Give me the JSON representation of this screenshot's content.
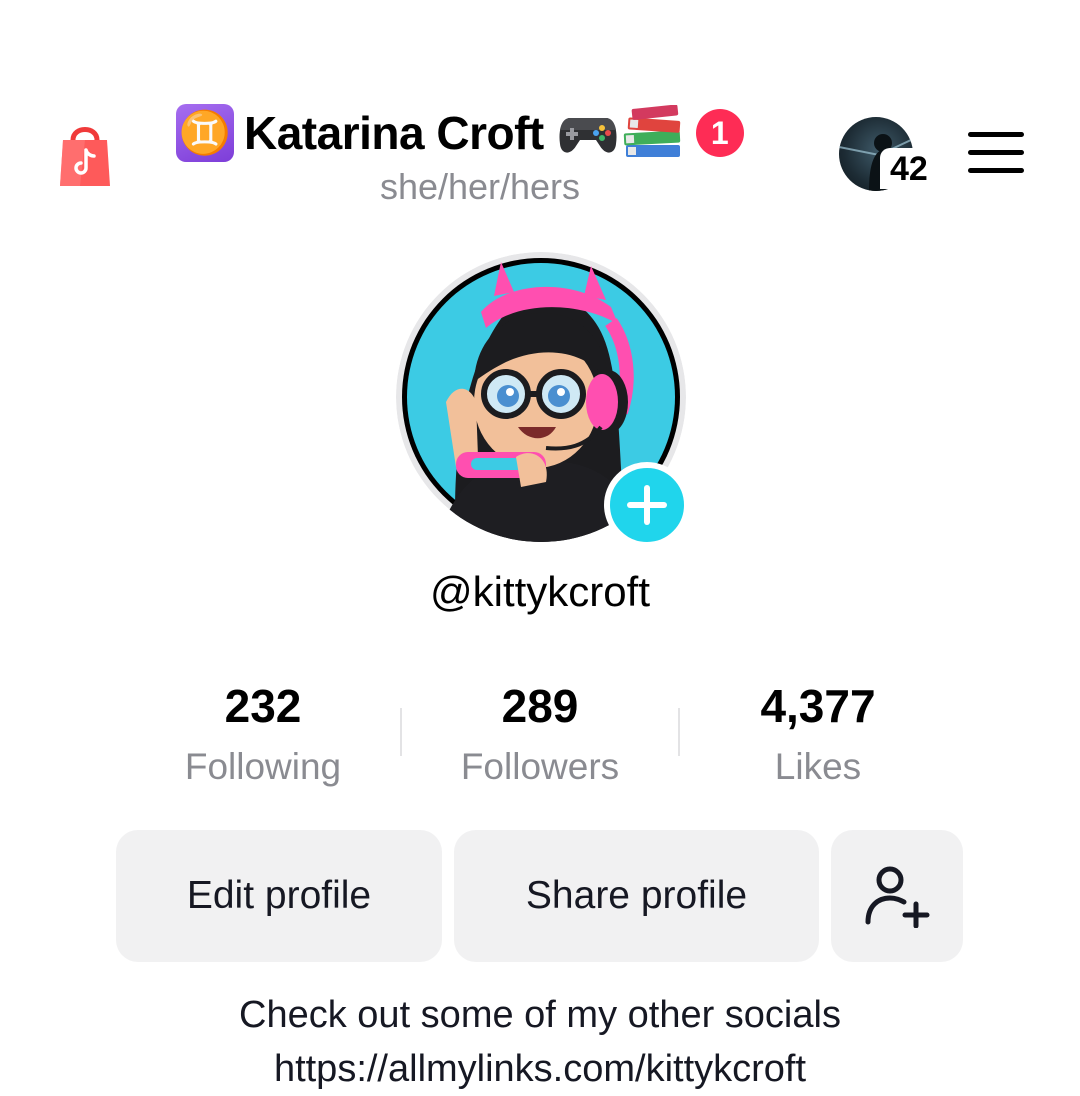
{
  "header": {
    "zodiac_symbol": "♊",
    "display_name": "Katarina Croft",
    "title_emoji_icons": [
      "game-controller-icon",
      "books-icon"
    ],
    "notification_count": "1",
    "pronouns": "she/her/hers",
    "account_badge_count": "42"
  },
  "profile": {
    "username": "@kittykcroft"
  },
  "stats": [
    {
      "value": "232",
      "label": "Following"
    },
    {
      "value": "289",
      "label": "Followers"
    },
    {
      "value": "4,377",
      "label": "Likes"
    }
  ],
  "actions": {
    "edit_profile": "Edit profile",
    "share_profile": "Share profile"
  },
  "bio": {
    "line1": "Check out some of my other socials",
    "line2": "https://allmylinks.com/kittykcroft"
  },
  "colors": {
    "notification_badge": "#fe2c55",
    "add_button": "#20d5ec",
    "shop_bag": "#fe4a4a",
    "button_bg": "#f1f1f2",
    "secondary_text": "#8a8b91"
  }
}
